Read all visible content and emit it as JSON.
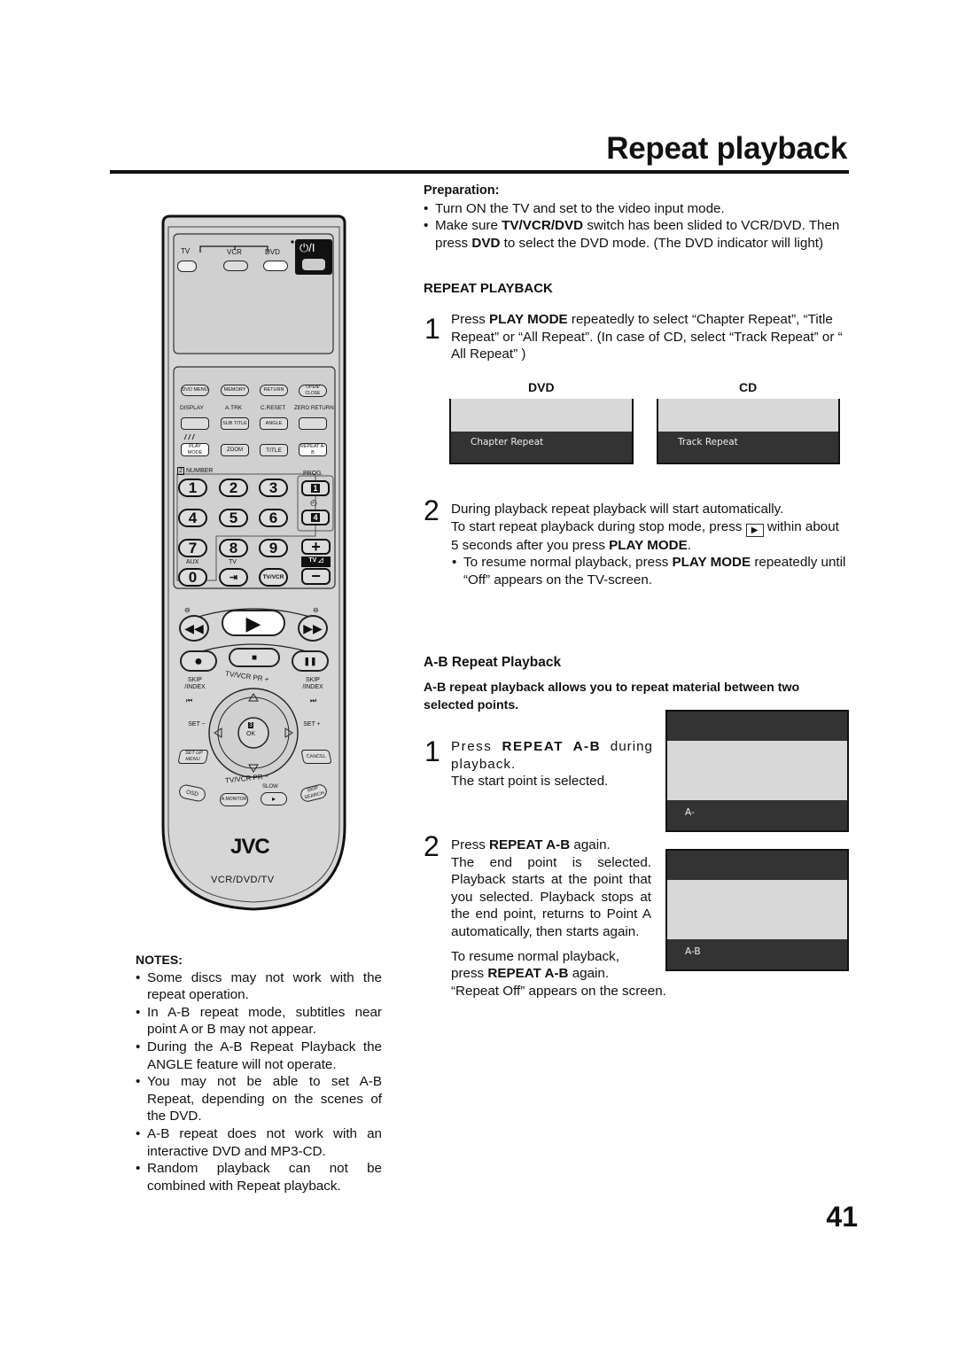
{
  "page": {
    "title": "Repeat playback",
    "page_number": "41"
  },
  "preparation": {
    "heading": "Preparation:",
    "bullet1": "Turn ON the TV and set to the video input mode.",
    "bullet2_pre": "Make sure ",
    "bullet2_b1": "TV/VCR/DVD",
    "bullet2_mid": " switch has been slided to VCR/DVD. Then press ",
    "bullet2_b2": "DVD",
    "bullet2_post": " to select the DVD mode. (The DVD indicator will light)"
  },
  "repeat_playback": {
    "heading": "REPEAT PLAYBACK",
    "step1": {
      "num": "1",
      "pre": "Press ",
      "bold": "PLAY MODE",
      "post": " repeatedly to select “Chapter Repeat”, “Title Repeat” or “All Repeat”. (In case of CD, select “Track Repeat” or “ All Repeat” )"
    },
    "screens": [
      {
        "heading": "DVD",
        "osd_text": "Chapter Repeat"
      },
      {
        "heading": "CD",
        "osd_text": "Track Repeat"
      }
    ],
    "step2": {
      "num": "2",
      "line1": "During playback repeat playback will start automatically.",
      "line2_pre": "To start repeat playback during stop mode, press ",
      "line2_post": " within about 5 seconds after you press ",
      "line2_bold": "PLAY MODE",
      "line2_end": ".",
      "bullet_pre": "To resume normal playback, press ",
      "bullet_bold": "PLAY MODE",
      "bullet_post": " repeatedly until “Off” appears on the TV-screen."
    }
  },
  "ab_repeat": {
    "heading": "A-B Repeat Playback",
    "intro": "A-B repeat playback allows you to repeat material between two selected points.",
    "step1": {
      "num": "1",
      "pre": "Press ",
      "bold": "REPEAT A-B",
      "post": " during playback.",
      "line2": "The start point is selected."
    },
    "step2": {
      "num": "2",
      "pre": "Press ",
      "bold": "REPEAT A-B",
      "post": " again.",
      "body": "The end point is selected. Playback starts at the point that you selected. Playback stops at the end point, returns to Point A automatically, then starts again.",
      "resume1": "To resume normal playback,",
      "resume2_pre": "press ",
      "resume2_bold": "REPEAT A-B",
      "resume2_post": " again.",
      "resume3": "“Repeat Off” appears on the screen."
    },
    "screens": [
      {
        "osd_text": "A-"
      },
      {
        "osd_text": "A-B"
      }
    ]
  },
  "notes": {
    "heading": "NOTES:",
    "items": [
      "Some discs may not work with the repeat operation.",
      "In A-B repeat mode, subtitles near point A or B may not appear.",
      "During the A-B Repeat Playback the ANGLE feature will not operate.",
      "You may not be able to set A-B Repeat, depending on the scenes of the DVD.",
      "A-B repeat does not work with an interactive DVD and MP3-CD.",
      "Random playback can not be combined with Repeat playback."
    ]
  },
  "remote": {
    "brand": "JVC",
    "model_text": "VCR/DVD/TV",
    "switch_labels": [
      "TV",
      "VCR",
      "DVD"
    ],
    "power_label": "⏻/I",
    "row1": [
      "DVD MENU",
      "MEMORY",
      "RETURN",
      "OPEN/ CLOSE"
    ],
    "row2_labels": [
      "DISPLAY",
      "A.TRK",
      "C.RESET",
      "ZERO RETURN"
    ],
    "row2_buttons": [
      "",
      "SUB TITLE",
      "ANGLE",
      ""
    ],
    "row3": [
      "PLAY MODE",
      "ZOOM",
      "TITLE",
      "REPEAT A-B"
    ],
    "number_label": "NUMBER",
    "number_badge": "2",
    "prog_label": "PROG.",
    "prog_badges": [
      "1",
      "4"
    ],
    "digits": [
      "1",
      "2",
      "3",
      "4",
      "5",
      "6",
      "7",
      "8",
      "9",
      "0"
    ],
    "aux_label": "AUX",
    "tv_label": "TV",
    "tvvcr_label": "TV/VCR",
    "vol_label": "TV",
    "skip_label": "SKIP /INDEX",
    "set_minus": "SET −",
    "set_plus": "SET +",
    "tvvcr_pr_plus": "TV/VCR PR +",
    "tvvcr_pr_minus": "TV/VCR PR −",
    "ok_badge": "3",
    "ok_label": "OK",
    "setup_menu": "SET UP MENU",
    "cancel": "CANCEL",
    "osd": "OSD",
    "amonitor": "A.MONITOR",
    "slow": "SLOW",
    "skip_search": "SKIP SEARCH"
  }
}
